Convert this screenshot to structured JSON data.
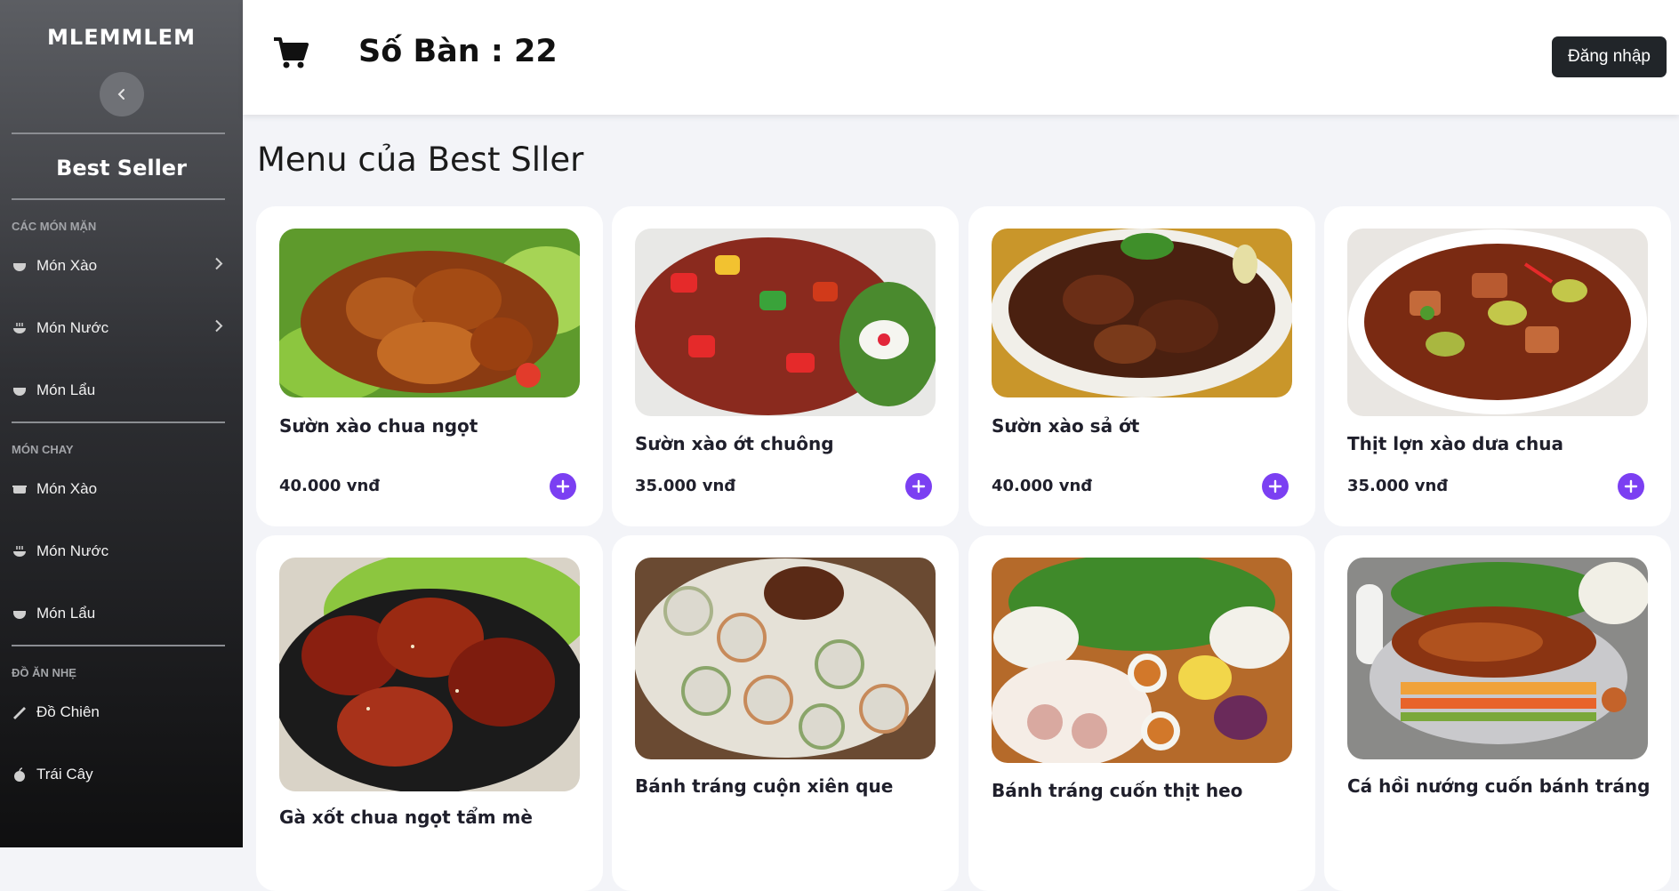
{
  "sidebar": {
    "brand": "MLEMMLEM",
    "best_seller": "Best Seller",
    "sections": [
      {
        "heading": "CÁC MÓN MẶN",
        "items": [
          {
            "label": "Món Xào",
            "icon": "bowl-icon",
            "has_chevron": true
          },
          {
            "label": "Món Nước",
            "icon": "bowl-steam-icon",
            "has_chevron": true
          },
          {
            "label": "Món Lẩu",
            "icon": "bowl-icon",
            "has_chevron": false
          }
        ]
      },
      {
        "heading": "MÓN CHAY",
        "items": [
          {
            "label": "Món Xào",
            "icon": "hotpot-icon",
            "has_chevron": false
          },
          {
            "label": "Món Nước",
            "icon": "bowl-steam-icon",
            "has_chevron": false
          },
          {
            "label": "Món Lẩu",
            "icon": "bowl-icon",
            "has_chevron": false
          }
        ]
      },
      {
        "heading": "ĐỒ ĂN NHẸ",
        "items": [
          {
            "label": "Đồ Chiên",
            "icon": "fries-icon",
            "has_chevron": false
          },
          {
            "label": "Trái Cây",
            "icon": "apple-icon",
            "has_chevron": false
          }
        ]
      }
    ]
  },
  "header": {
    "table_label": "Số Bàn : 22",
    "login_label": "Đăng nhập"
  },
  "main": {
    "title": "Menu của Best Sller",
    "products": [
      {
        "name": "Sườn xào chua ngọt",
        "price": "40.000 vnđ"
      },
      {
        "name": "Sườn xào ớt chuông",
        "price": "35.000 vnđ"
      },
      {
        "name": "Sườn xào sả ớt",
        "price": "40.000 vnđ"
      },
      {
        "name": "Thịt lợn xào dưa chua",
        "price": "35.000 vnđ"
      },
      {
        "name": "Gà xốt chua ngọt tẩm mè",
        "price": ""
      },
      {
        "name": "Bánh tráng cuộn xiên que",
        "price": ""
      },
      {
        "name": "Bánh tráng cuốn thịt heo",
        "price": ""
      },
      {
        "name": "Cá hồi nướng cuốn bánh tráng",
        "price": ""
      }
    ]
  },
  "colors": {
    "accent": "#7b3ff2",
    "header_bg": "#ffffff",
    "page_bg": "#f3f4f8",
    "button_dark": "#212529"
  }
}
